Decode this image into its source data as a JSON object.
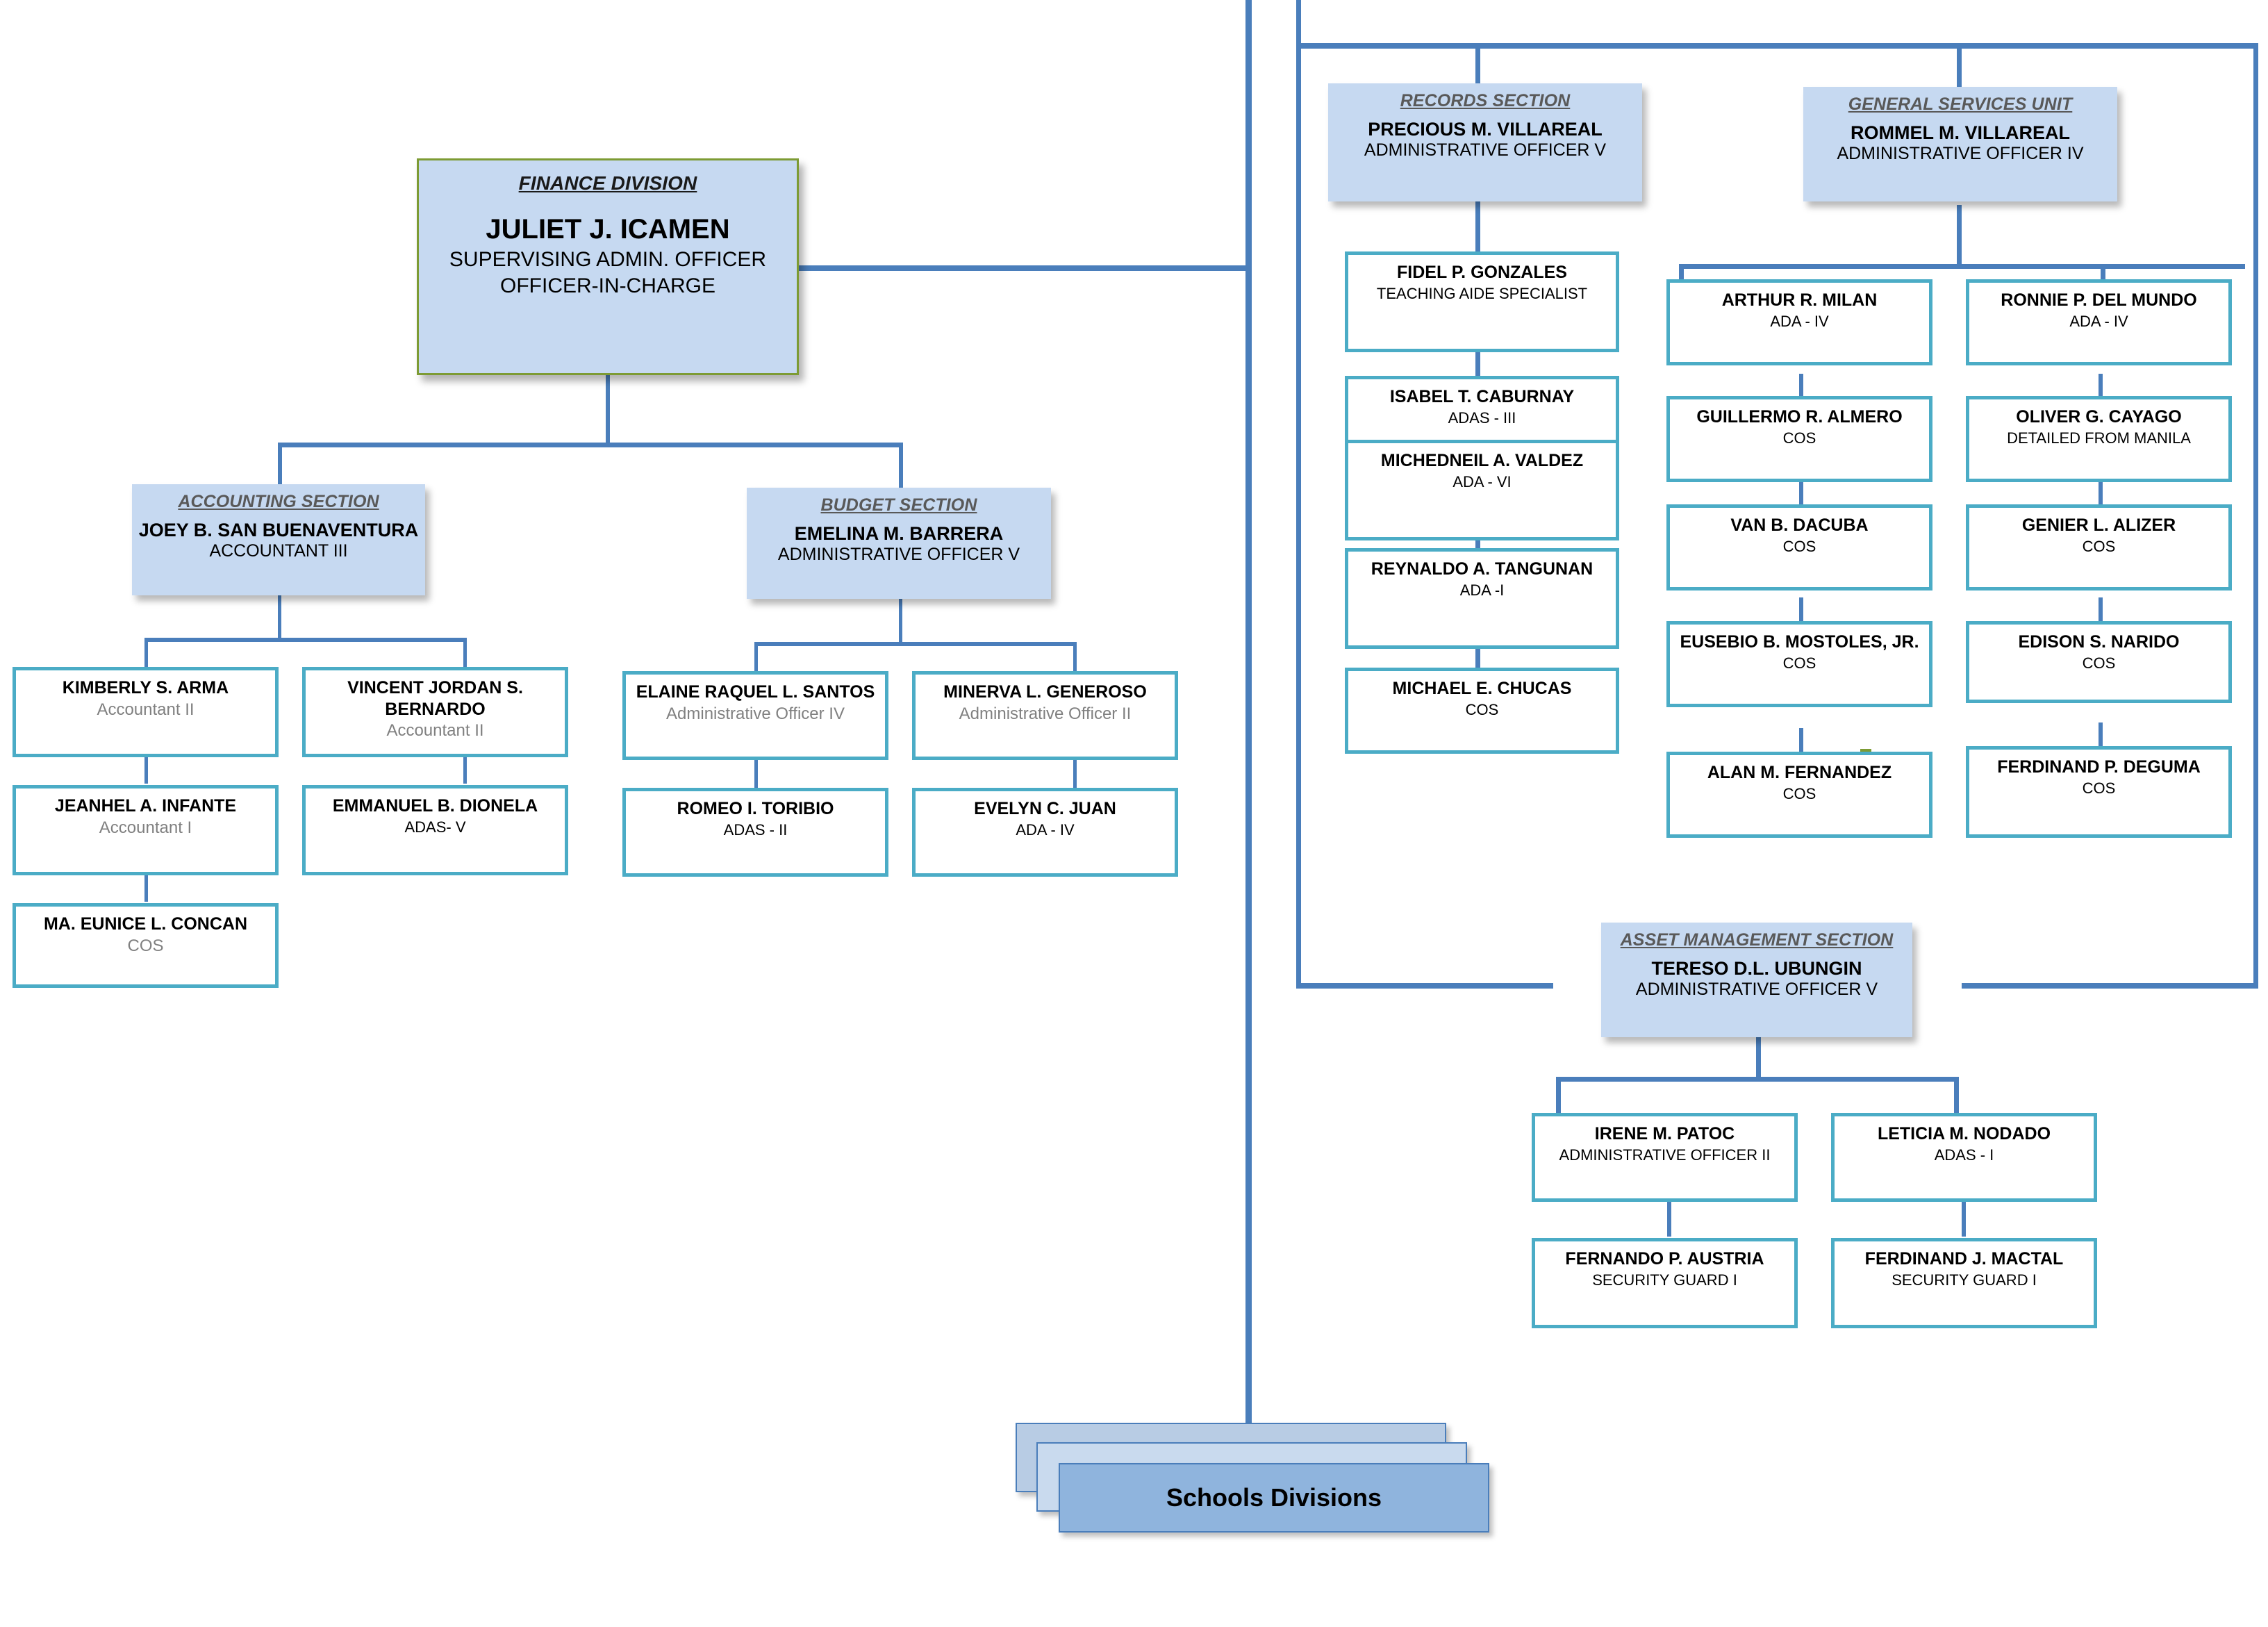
{
  "root": {
    "section": "FINANCE DIVISION",
    "name": "JULIET J. ICAMEN",
    "position1": "SUPERVISING ADMIN. OFFICER",
    "position2": "OFFICER-IN-CHARGE"
  },
  "accounting": {
    "section": "ACCOUNTING SECTION",
    "name": "JOEY B. SAN BUENAVENTURA",
    "position": "ACCOUNTANT III",
    "left": [
      {
        "name": "KIMBERLY S. ARMA",
        "position": "Accountant II"
      },
      {
        "name": "JEANHEL A. INFANTE",
        "position": "Accountant I"
      },
      {
        "name": "MA. EUNICE L. CONCAN",
        "position": "COS"
      }
    ],
    "right": [
      {
        "name": "VINCENT JORDAN S. BERNARDO",
        "position": "Accountant II"
      },
      {
        "name": "EMMANUEL B. DIONELA",
        "position": "ADAS- V"
      }
    ]
  },
  "budget": {
    "section": "BUDGET SECTION",
    "name": "EMELINA M. BARRERA",
    "position": "ADMINISTRATIVE OFFICER V",
    "left": [
      {
        "name": "ELAINE RAQUEL L. SANTOS",
        "position": "Administrative Officer IV"
      },
      {
        "name": "ROMEO I. TORIBIO",
        "position": "ADAS - II"
      }
    ],
    "right": [
      {
        "name": "MINERVA L. GENEROSO",
        "position": "Administrative Officer II"
      },
      {
        "name": "EVELYN C. JUAN",
        "position": "ADA - IV"
      }
    ]
  },
  "records": {
    "section": "RECORDS SECTION",
    "name": "PRECIOUS M. VILLAREAL",
    "position": "ADMINISTRATIVE OFFICER V",
    "staff": [
      {
        "name": "FIDEL P. GONZALES",
        "position": "TEACHING AIDE SPECIALIST"
      },
      {
        "name": "ISABEL T. CABURNAY",
        "position": "ADAS - III"
      },
      {
        "name": "MICHEDNEIL A. VALDEZ",
        "position": "ADA - VI"
      },
      {
        "name": "REYNALDO A. TANGUNAN",
        "position": "ADA -I"
      },
      {
        "name": "MICHAEL E. CHUCAS",
        "position": "COS"
      }
    ]
  },
  "gsu": {
    "section": "GENERAL SERVICES UNIT",
    "name": "ROMMEL M. VILLAREAL",
    "position": "ADMINISTRATIVE OFFICER IV",
    "left": [
      {
        "name": "ARTHUR R. MILAN",
        "position": "ADA - IV"
      },
      {
        "name": "GUILLERMO R. ALMERO",
        "position": "COS"
      },
      {
        "name": "VAN B. DACUBA",
        "position": "COS"
      },
      {
        "name": "EUSEBIO B. MOSTOLES, JR.",
        "position": "COS"
      },
      {
        "name": "ALAN M. FERNANDEZ",
        "position": "COS"
      }
    ],
    "right": [
      {
        "name": "RONNIE P. DEL MUNDO",
        "position": "ADA - IV"
      },
      {
        "name": "OLIVER G. CAYAGO",
        "position": "DETAILED FROM MANILA"
      },
      {
        "name": "GENIER L. ALIZER",
        "position": "COS"
      },
      {
        "name": "EDISON S. NARIDO",
        "position": "COS"
      },
      {
        "name": "FERDINAND P. DEGUMA",
        "position": "COS"
      }
    ]
  },
  "asset": {
    "section": "ASSET MANAGEMENT SECTION",
    "name": "TERESO D.L. UBUNGIN",
    "position": "ADMINISTRATIVE OFFICER V",
    "left": [
      {
        "name": "IRENE M. PATOC",
        "position": "ADMINISTRATIVE OFFICER II"
      },
      {
        "name": "FERNANDO P. AUSTRIA",
        "position": "SECURITY GUARD I"
      }
    ],
    "right": [
      {
        "name": "LETICIA M. NODADO",
        "position": "ADAS - I"
      },
      {
        "name": "FERDINAND J. MACTAL",
        "position": "SECURITY GUARD I"
      }
    ]
  },
  "schools": {
    "label": "Schools Divisions"
  },
  "colors": {
    "connector": "#4a7ebb",
    "manager_fill": "#c6d9f1",
    "staff_border": "#4bacc6",
    "root_border": "#7d9b34",
    "section_title": "#595959",
    "muted_text": "#808080",
    "schools_front": "#8fb4dd"
  }
}
